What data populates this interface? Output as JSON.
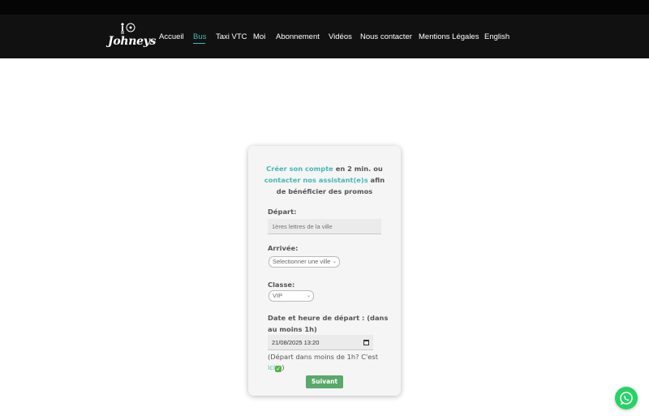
{
  "brand": {
    "name": "Johneys"
  },
  "nav": {
    "items": [
      {
        "label": "Accueil",
        "active": false
      },
      {
        "label": "Bus",
        "active": true
      },
      {
        "label": "Taxi VTC",
        "active": false
      },
      {
        "label": "Moi",
        "active": false
      },
      {
        "label": "Abonnement",
        "active": false
      },
      {
        "label": "Vidéos",
        "active": false
      },
      {
        "label": "Nous contacter",
        "active": false
      },
      {
        "label": "Mentions Légales",
        "active": false
      },
      {
        "label": "English",
        "active": false
      }
    ]
  },
  "form": {
    "intro": {
      "link1": "Créer son compte",
      "text1": " en 2 min. ou",
      "link2": "contacter nos assistant(e)s",
      "text2": " afin",
      "text3": "de bénéficier des promos"
    },
    "departure": {
      "label": "Départ:",
      "placeholder": "1ères lettres de la ville"
    },
    "arrival": {
      "label": "Arrivée:",
      "selected": "Selectionner une ville"
    },
    "class": {
      "label": "Classe:",
      "selected": "VIP"
    },
    "datetime": {
      "label_line1": "Date et heure de départ : (dans",
      "label_line2": "au moins 1h)",
      "value": "21/08/2025 13:20"
    },
    "note": {
      "prefix": " (Départ dans moins de 1h? C'est",
      "link": "ici",
      "suffix": ")"
    },
    "submit_label": "Suivant"
  },
  "colors": {
    "accent": "#45b8b5",
    "button": "#5aa86a",
    "whatsapp": "#25d366",
    "navbar": "#111111"
  },
  "icons": {
    "whatsapp": "whatsapp-icon",
    "calendar": "calendar-icon",
    "check": "check-icon"
  }
}
